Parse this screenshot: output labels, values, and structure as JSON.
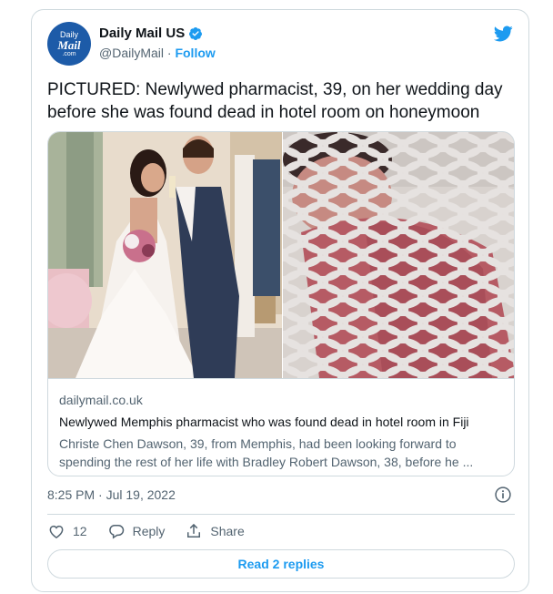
{
  "account": {
    "avatar_line1": "Daily",
    "avatar_line2": "Mail",
    "avatar_line3": ".com",
    "name": "Daily Mail US",
    "handle": "@DailyMail",
    "separator": " · ",
    "follow_label": "Follow",
    "verified_icon": "verified-badge-icon"
  },
  "tweet": {
    "text": "PICTURED: Newlywed pharmacist, 39, on her wedding day before she was found dead in hotel room on honeymoon"
  },
  "link_card": {
    "domain": "dailymail.co.uk",
    "title": "Newlywed Memphis pharmacist who was found dead in hotel room in Fiji",
    "description": "Christe Chen Dawson, 39, from Memphis, had been looking forward to spending the rest of her life with Bradley Robert Dawson, 38, before he ..."
  },
  "meta": {
    "timestamp": "8:25 PM · Jul 19, 2022"
  },
  "actions": {
    "like_count": "12",
    "reply_label": "Reply",
    "share_label": "Share"
  },
  "footer": {
    "read_replies_label": "Read 2 replies"
  },
  "colors": {
    "accent": "#1d9bf0",
    "secondary_text": "#536471",
    "border": "#cfd9de"
  }
}
